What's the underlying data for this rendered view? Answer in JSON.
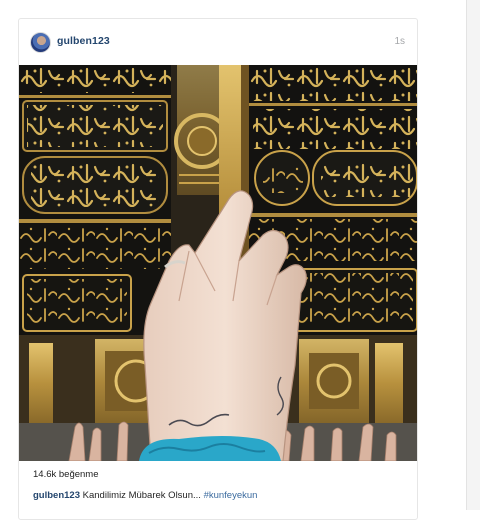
{
  "post": {
    "username": "gulben123",
    "time_ago": "1s",
    "likes_text": "14.6k beğenme",
    "caption_user": "gulben123",
    "caption_text": "Kandilimiz Mübarek Olsun...",
    "caption_hashtag": "#kunfeyekun"
  },
  "colors": {
    "username": "#24466e",
    "hashtag": "#3b6b9f",
    "gold": "#c9a24a",
    "kiswa_black": "#151411",
    "bracelet": "#2aa7c9"
  },
  "icons": {
    "avatar": "profile-avatar"
  }
}
